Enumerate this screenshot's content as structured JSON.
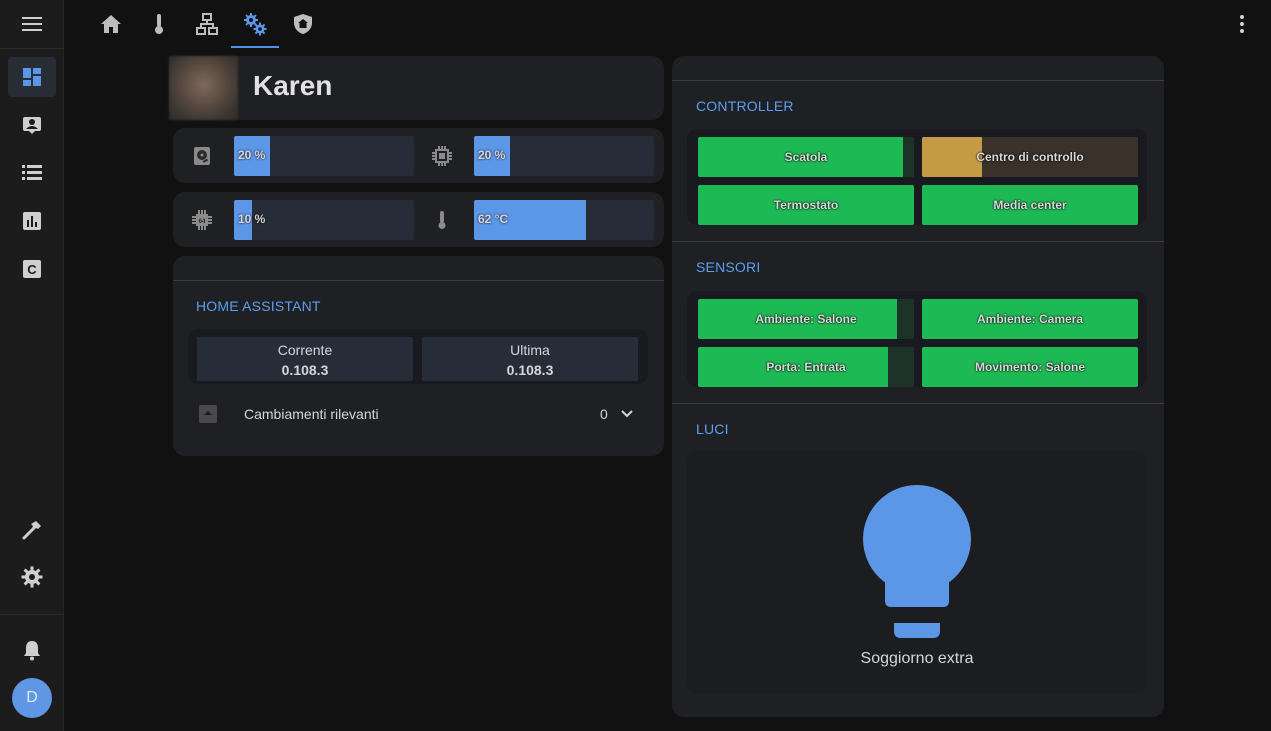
{
  "colors": {
    "accent": "#5c96e6",
    "success": "#1db954",
    "warning": "#c49a45",
    "card": "#1f2024",
    "background": "#111111"
  },
  "sidebar": {
    "items": [
      {
        "icon": "dashboard-icon"
      },
      {
        "icon": "person-card-icon"
      },
      {
        "icon": "list-icon"
      },
      {
        "icon": "chart-icon"
      },
      {
        "icon": "c-box-icon"
      }
    ],
    "bottom": [
      {
        "icon": "hammer-icon"
      },
      {
        "icon": "gear-icon"
      },
      {
        "icon": "bell-icon"
      }
    ],
    "avatar_initial": "D"
  },
  "topbar": {
    "tabs": [
      {
        "icon": "home-icon"
      },
      {
        "icon": "thermometer-icon"
      },
      {
        "icon": "network-icon"
      },
      {
        "icon": "gears-icon"
      },
      {
        "icon": "shield-home-icon"
      }
    ],
    "active_tab": 3
  },
  "profile": {
    "name": "Karen"
  },
  "stats": [
    {
      "icon": "harddisk-icon",
      "value": "20 %",
      "fraction": 0.2
    },
    {
      "icon": "chip-icon",
      "value": "20 %",
      "fraction": 0.2
    },
    {
      "icon": "memory-icon",
      "value": "10 %",
      "fraction": 0.1
    },
    {
      "icon": "thermometer-icon",
      "value": "62 °C",
      "fraction": 0.62
    }
  ],
  "home_assistant": {
    "title": "HOME ASSISTANT",
    "current_label": "Corrente",
    "current_value": "0.108.3",
    "latest_label": "Ultima",
    "latest_value": "0.108.3",
    "changes_label": "Cambiamenti rilevanti",
    "changes_count": "0"
  },
  "controller": {
    "title": "CONTROLLER",
    "buttons": [
      {
        "label": "Scatola",
        "fraction": 0.95
      },
      {
        "label": "Centro di controllo",
        "fraction": 0.28
      },
      {
        "label": "Termostato",
        "fraction": 1.0
      },
      {
        "label": "Media center",
        "fraction": 1.0
      }
    ]
  },
  "sensors": {
    "title": "SENSORI",
    "buttons": [
      {
        "label": "Ambiente: Salone",
        "fraction": 0.92
      },
      {
        "label": "Ambiente: Camera",
        "fraction": 1.0
      },
      {
        "label": "Porta: Entrata",
        "fraction": 0.88
      },
      {
        "label": "Movimento: Salone",
        "fraction": 1.0
      }
    ]
  },
  "lights": {
    "title": "LUCI",
    "label": "Soggiorno extra",
    "icon": "lightbulb-icon"
  }
}
